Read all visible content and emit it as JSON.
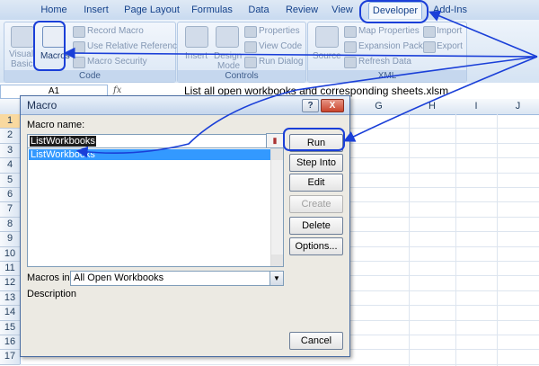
{
  "tabs": [
    {
      "label": "Home"
    },
    {
      "label": "Insert"
    },
    {
      "label": "Page Layout"
    },
    {
      "label": "Formulas"
    },
    {
      "label": "Data"
    },
    {
      "label": "Review"
    },
    {
      "label": "View"
    },
    {
      "label": "Developer",
      "active": true
    },
    {
      "label": "Add-Ins"
    }
  ],
  "ribbon": {
    "code_group": {
      "label": "Code",
      "visual_basic_line1": "Visual",
      "visual_basic_line2": "Basic",
      "macros": "Macros",
      "record_macro": "Record Macro",
      "use_relative_refs": "Use Relative References",
      "macro_security": "Macro Security"
    },
    "controls_group": {
      "label": "Controls",
      "insert": "Insert",
      "design_mode_line1": "Design",
      "design_mode_line2": "Mode",
      "properties": "Properties",
      "view_code": "View Code",
      "run_dialog": "Run Dialog"
    },
    "xml_group": {
      "label": "XML",
      "source": "Source",
      "map_properties": "Map Properties",
      "expansion_packs": "Expansion Packs",
      "refresh_data": "Refresh Data",
      "import": "Import",
      "export": "Export"
    }
  },
  "formula_bar": {
    "name_box": "A1",
    "fx": "fx",
    "content": "List all open workbooks and corresponding sheets.xlsm"
  },
  "columns": [
    "G",
    "H",
    "I",
    "J"
  ],
  "rows": [
    "1",
    "2",
    "3",
    "4",
    "5",
    "6",
    "7",
    "8",
    "9",
    "10",
    "11",
    "12",
    "13",
    "14",
    "15",
    "16",
    "17"
  ],
  "dialog": {
    "title": "Macro",
    "help": "?",
    "close": "X",
    "macro_name_label": "Macro name:",
    "macro_name_value": "ListWorkbooks",
    "list_items": [
      "ListWorkbooks"
    ],
    "macros_in_label": "Macros in:",
    "macros_in_value": "All Open Workbooks",
    "description_label": "Description",
    "buttons": {
      "run": "Run",
      "step_into": "Step Into",
      "edit": "Edit",
      "create": "Create",
      "delete": "Delete",
      "options": "Options...",
      "cancel": "Cancel"
    }
  },
  "annotation_color": "#1a3fd8"
}
